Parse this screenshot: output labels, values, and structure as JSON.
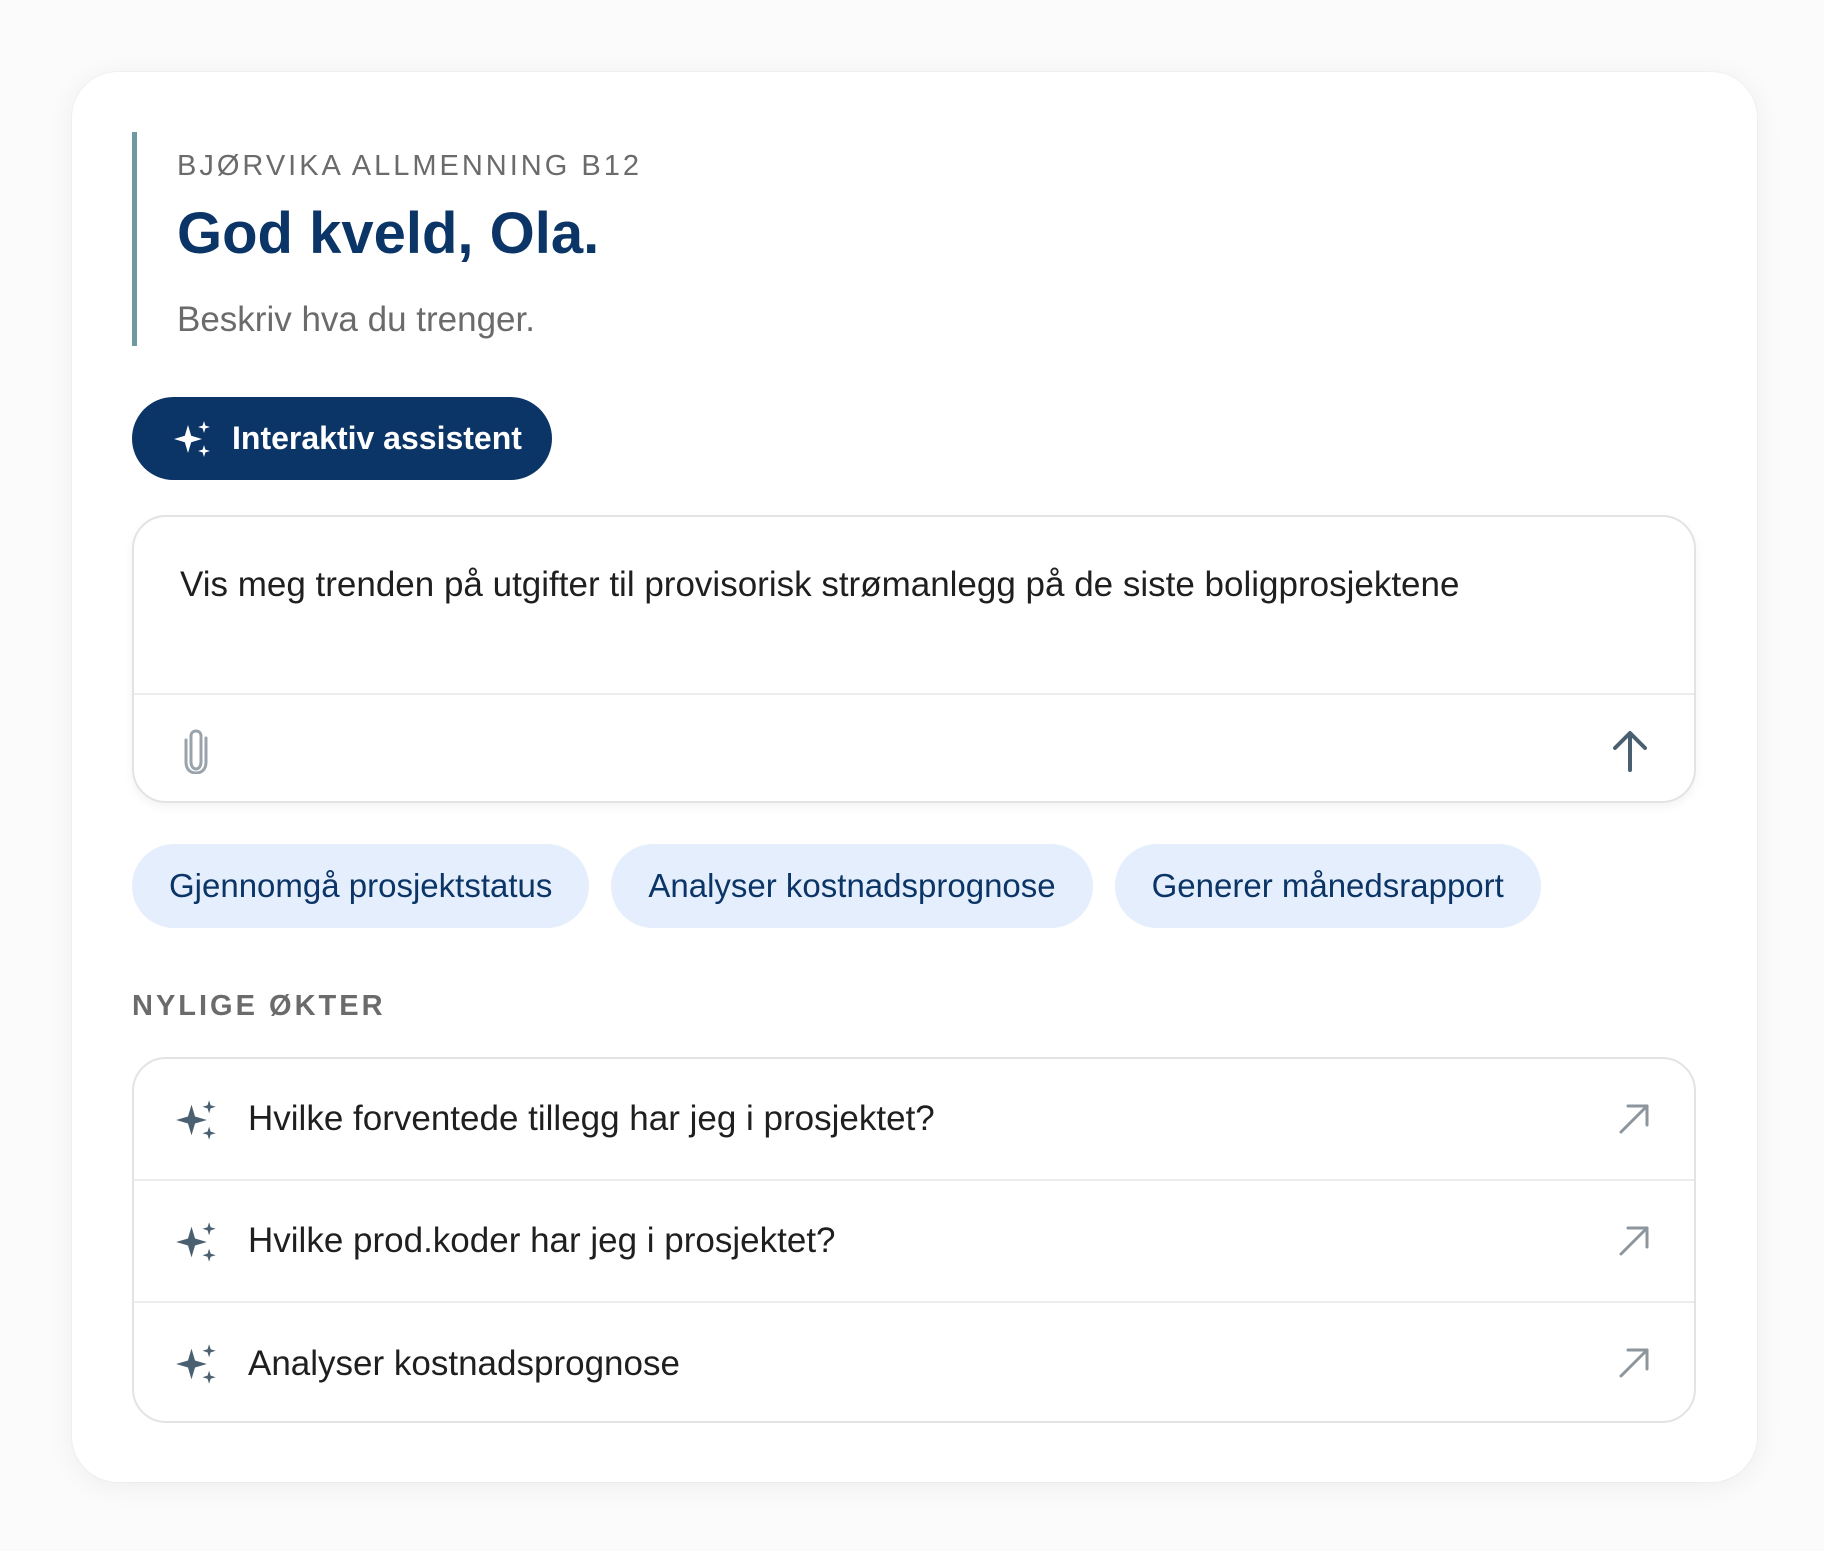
{
  "project": {
    "label": "BJØRVIKA ALLMENNING B12"
  },
  "greeting": {
    "title": "God kveld, Ola.",
    "subtitle": "Beskriv hva du trenger."
  },
  "assistant_button": {
    "label": "Interaktiv assistent",
    "icon": "sparkles-icon"
  },
  "prompt_input": {
    "value": "Vis meg trenden på utgifter til provisorisk strømanlegg på de siste boligprosjektene",
    "attach_icon": "paperclip-icon",
    "send_icon": "arrow-up-icon"
  },
  "suggestions": [
    {
      "label": "Gjennomgå prosjektstatus"
    },
    {
      "label": "Analyser kostnadsprognose"
    },
    {
      "label": "Generer månedsrapport"
    }
  ],
  "recent_sessions": {
    "title": "NYLIGE ØKTER",
    "items": [
      {
        "label": "Hvilke forventede tillegg har jeg i prosjektet?",
        "icon": "sparkles-icon",
        "action_icon": "arrow-up-right-icon"
      },
      {
        "label": "Hvilke prod.koder har jeg i prosjektet?",
        "icon": "sparkles-icon",
        "action_icon": "arrow-up-right-icon"
      },
      {
        "label": "Analyser kostnadsprognose",
        "icon": "sparkles-icon",
        "action_icon": "arrow-up-right-icon"
      }
    ]
  },
  "colors": {
    "brand_navy": "#0b3566",
    "accent_teal": "#6d9aa0",
    "chip_background": "#e5eefc",
    "muted_text": "#6b6b6b",
    "icon_slate": "#4a6070"
  }
}
